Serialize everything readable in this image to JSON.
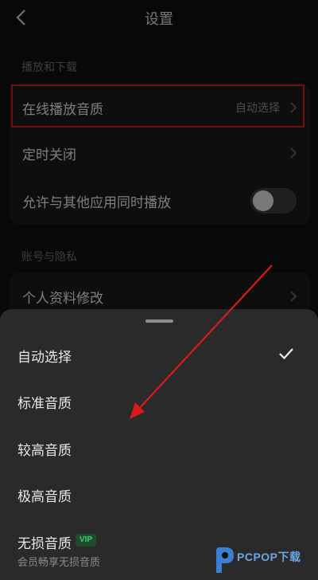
{
  "header": {
    "title": "设置",
    "back_icon": "chevron-left-icon"
  },
  "sections": [
    {
      "label": "播放和下载",
      "rows": [
        {
          "label": "在线播放音质",
          "value": "自动选择",
          "control": "chevron"
        },
        {
          "label": "定时关闭",
          "control": "chevron"
        },
        {
          "label": "允许与其他应用同时播放",
          "control": "toggle",
          "toggle_on": false
        }
      ]
    },
    {
      "label": "账号与隐私",
      "rows": [
        {
          "label": "个人资料修改",
          "control": "chevron"
        }
      ]
    }
  ],
  "sheet": {
    "options": [
      {
        "label": "自动选择",
        "selected": true
      },
      {
        "label": "标准音质",
        "selected": false
      },
      {
        "label": "较高音质",
        "selected": false
      },
      {
        "label": "极高音质",
        "selected": false
      },
      {
        "label": "无损音质",
        "selected": false,
        "badge": "VIP",
        "subtitle": "会员畅享无损音质"
      }
    ]
  },
  "watermark": {
    "text": "PCPOP下载"
  },
  "colors": {
    "background": "#0f0f0f",
    "card": "#1b1b1b",
    "sheet": "#2a2a2a",
    "highlight": "#d81a1a",
    "vip": "#3fce6f",
    "watermark": "#6aa6e6"
  }
}
